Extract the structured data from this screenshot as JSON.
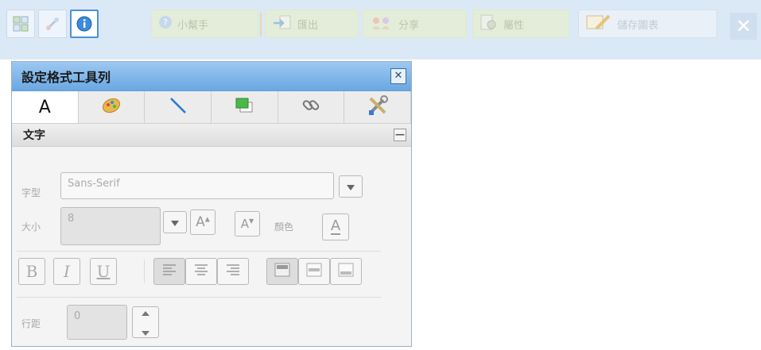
{
  "toolbar": {
    "help_label": "小幫手",
    "export_label": "匯出",
    "share_label": "分享",
    "properties_label": "屬性",
    "save_chart_label": "儲存圖表",
    "close_glyph": "✕"
  },
  "panel": {
    "title": "設定格式工具列",
    "close_glyph": "✕",
    "tabs": [
      {
        "label": "A",
        "icon": "text-icon"
      },
      {
        "label": "",
        "icon": "fill-color-icon"
      },
      {
        "label": "",
        "icon": "line-icon"
      },
      {
        "label": "",
        "icon": "layer-icon"
      },
      {
        "label": "",
        "icon": "link-icon"
      },
      {
        "label": "",
        "icon": "tools-icon"
      }
    ],
    "section_title": "文字",
    "collapse_glyph": "—",
    "font_label": "字型",
    "font_value": "Sans-Serif",
    "size_label": "大小",
    "size_value": "8",
    "color_label": "顏色",
    "color_btn_text": "A",
    "grow_text": "A",
    "shrink_text": "A",
    "bold_text": "B",
    "italic_text": "I",
    "underline_text": "U",
    "line_spacing_label": "行距",
    "line_spacing_value": "0"
  },
  "colors": {
    "toolbar_bg": "#dbe9f7",
    "panel_title_bg": "#6aa7e2",
    "accent": "#4a90d9"
  }
}
